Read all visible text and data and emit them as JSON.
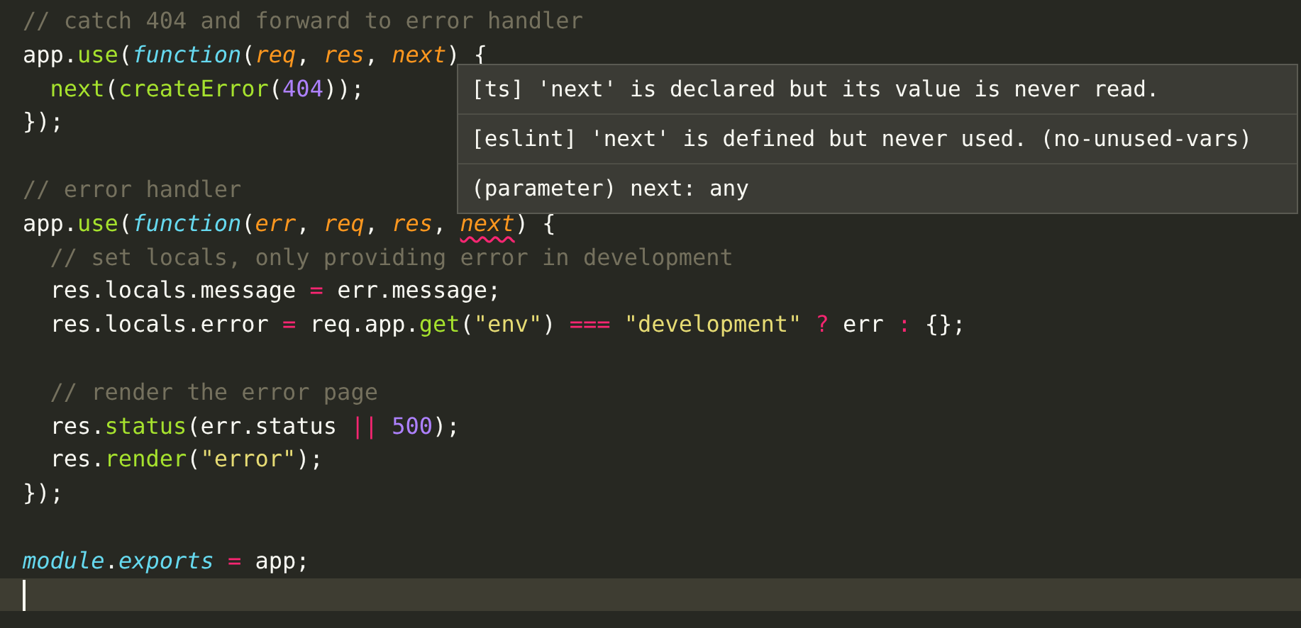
{
  "editor": {
    "lines": [
      {
        "current": false,
        "tokens": [
          {
            "kind": "comment",
            "text": "// catch 404 and forward to error handler"
          }
        ]
      },
      {
        "current": false,
        "tokens": [
          {
            "kind": "plain",
            "text": "app."
          },
          {
            "kind": "function",
            "text": "use"
          },
          {
            "kind": "plain",
            "text": "("
          },
          {
            "kind": "keyword",
            "text": "function"
          },
          {
            "kind": "plain",
            "text": "("
          },
          {
            "kind": "param",
            "text": "req"
          },
          {
            "kind": "plain",
            "text": ", "
          },
          {
            "kind": "param",
            "text": "res"
          },
          {
            "kind": "plain",
            "text": ", "
          },
          {
            "kind": "param",
            "text": "next"
          },
          {
            "kind": "plain",
            "text": ") {"
          }
        ]
      },
      {
        "current": false,
        "tokens": [
          {
            "kind": "function",
            "text": "  next"
          },
          {
            "kind": "plain",
            "text": "("
          },
          {
            "kind": "function",
            "text": "createError"
          },
          {
            "kind": "plain",
            "text": "("
          },
          {
            "kind": "number",
            "text": "404"
          },
          {
            "kind": "plain",
            "text": "));"
          }
        ]
      },
      {
        "current": false,
        "tokens": [
          {
            "kind": "plain",
            "text": "});"
          }
        ]
      },
      {
        "current": false
      },
      {
        "current": false,
        "tokens": [
          {
            "kind": "comment",
            "text": "// error handler"
          }
        ]
      },
      {
        "current": false,
        "tokens": [
          {
            "kind": "plain",
            "text": "app."
          },
          {
            "kind": "function",
            "text": "use"
          },
          {
            "kind": "plain",
            "text": "("
          },
          {
            "kind": "keyword",
            "text": "function"
          },
          {
            "kind": "plain",
            "text": "("
          },
          {
            "kind": "param",
            "text": "err"
          },
          {
            "kind": "plain",
            "text": ", "
          },
          {
            "kind": "param",
            "text": "req"
          },
          {
            "kind": "plain",
            "text": ", "
          },
          {
            "kind": "param",
            "text": "res"
          },
          {
            "kind": "plain",
            "text": ", "
          },
          {
            "kind": "param_unused",
            "text": "next"
          },
          {
            "kind": "plain",
            "text": ") {"
          }
        ]
      },
      {
        "current": false,
        "tokens": [
          {
            "kind": "comment",
            "text": "  // set locals, only providing error in development"
          }
        ]
      },
      {
        "current": false,
        "tokens": [
          {
            "kind": "plain",
            "text": "  res.locals.message "
          },
          {
            "kind": "operator",
            "text": "="
          },
          {
            "kind": "plain",
            "text": " err.message;"
          }
        ]
      },
      {
        "current": false,
        "tokens": [
          {
            "kind": "plain",
            "text": "  res.locals.error "
          },
          {
            "kind": "operator",
            "text": "="
          },
          {
            "kind": "plain",
            "text": " req.app."
          },
          {
            "kind": "function",
            "text": "get"
          },
          {
            "kind": "plain",
            "text": "("
          },
          {
            "kind": "string",
            "text": "\"env\""
          },
          {
            "kind": "plain",
            "text": ") "
          },
          {
            "kind": "operator",
            "text": "==="
          },
          {
            "kind": "string",
            "text": " \"development\""
          },
          {
            "kind": "operator",
            "text": " ?"
          },
          {
            "kind": "plain",
            "text": " err "
          },
          {
            "kind": "operator",
            "text": ":"
          },
          {
            "kind": "plain",
            "text": " {};"
          }
        ]
      },
      {
        "current": false
      },
      {
        "current": false,
        "tokens": [
          {
            "kind": "comment",
            "text": "  // render the error page"
          }
        ]
      },
      {
        "current": false,
        "tokens": [
          {
            "kind": "plain",
            "text": "  res."
          },
          {
            "kind": "function",
            "text": "status"
          },
          {
            "kind": "plain",
            "text": "(err.status "
          },
          {
            "kind": "operator",
            "text": "||"
          },
          {
            "kind": "number",
            "text": " 500"
          },
          {
            "kind": "plain",
            "text": ");"
          }
        ]
      },
      {
        "current": false,
        "tokens": [
          {
            "kind": "plain",
            "text": "  res."
          },
          {
            "kind": "function",
            "text": "render"
          },
          {
            "kind": "plain",
            "text": "("
          },
          {
            "kind": "string",
            "text": "\"error\""
          },
          {
            "kind": "plain",
            "text": ");"
          }
        ]
      },
      {
        "current": false,
        "tokens": [
          {
            "kind": "plain",
            "text": "});"
          }
        ]
      },
      {
        "current": false
      },
      {
        "current": false,
        "tokens": [
          {
            "kind": "support",
            "text": "module"
          },
          {
            "kind": "plain",
            "text": "."
          },
          {
            "kind": "support",
            "text": "exports"
          },
          {
            "kind": "operator",
            "text": " ="
          },
          {
            "kind": "plain",
            "text": " app;"
          }
        ]
      },
      {
        "current": true
      }
    ]
  },
  "hover": {
    "messages": [
      "[ts] 'next' is declared but its value is never read.",
      "[eslint] 'next' is defined but never used. (no-unused-vars)",
      "(parameter) next: any"
    ]
  }
}
